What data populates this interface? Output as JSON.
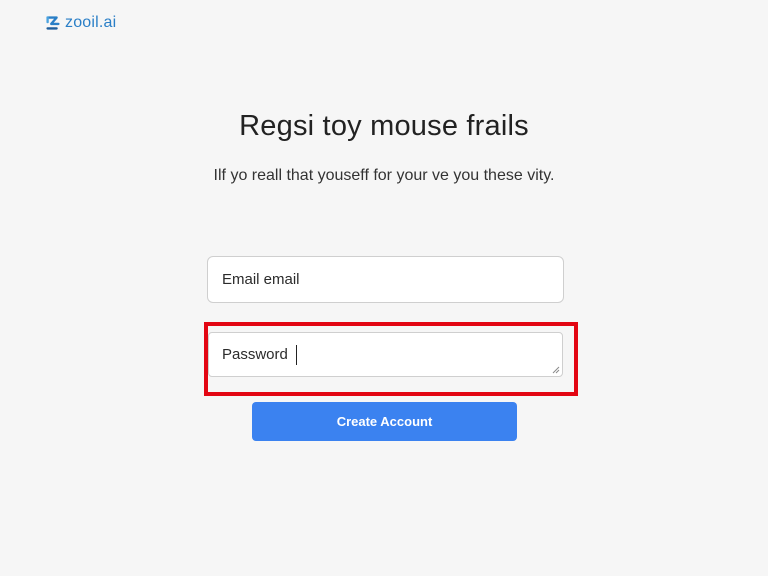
{
  "brand": {
    "name": "zooil.ai",
    "icon": "zooil-logo-icon",
    "color": "#2a7fc7"
  },
  "header": {
    "title": "Regsi toy mouse frails",
    "subtitle": "Ilf yo reall that youseff for your ve you these vity."
  },
  "form": {
    "email": {
      "value": "Email email"
    },
    "password": {
      "value": "Password",
      "highlight_color": "#e30613"
    },
    "submit_label": "Create Account",
    "submit_color": "#3b82f0"
  }
}
